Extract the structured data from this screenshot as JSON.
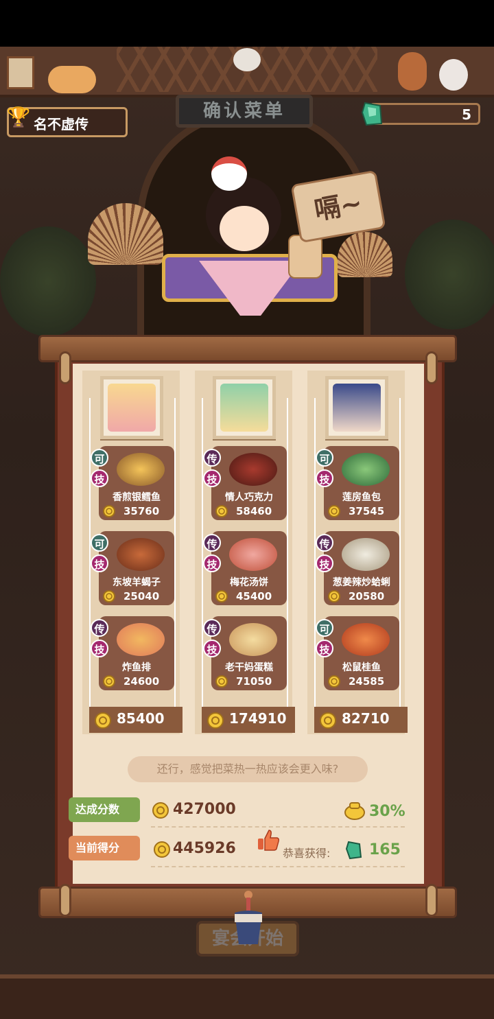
{
  "header": {
    "title_badge": "名不虚传",
    "sign_text": "确认菜单",
    "gem_count": "5"
  },
  "chef": {
    "speech": "嗝~"
  },
  "columns": [
    {
      "portrait": "chef-portrait-1",
      "dishes": [
        {
          "badge": "可",
          "skill": "技",
          "name": "香煎银鳕鱼",
          "price": "35760"
        },
        {
          "badge": "可",
          "skill": "技",
          "name": "东坡羊蝎子",
          "price": "25040"
        },
        {
          "badge": "传",
          "skill": "技",
          "name": "炸鱼排",
          "price": "24600"
        }
      ],
      "total": "85400"
    },
    {
      "portrait": "chef-portrait-2",
      "dishes": [
        {
          "badge": "传",
          "skill": "技",
          "name": "情人巧克力",
          "price": "58460"
        },
        {
          "badge": "传",
          "skill": "技",
          "name": "梅花汤饼",
          "price": "45400"
        },
        {
          "badge": "传",
          "skill": "技",
          "name": "老干妈蛋糕",
          "price": "71050"
        }
      ],
      "total": "174910"
    },
    {
      "portrait": "chef-portrait-3",
      "dishes": [
        {
          "badge": "可",
          "skill": "技",
          "name": "莲房鱼包",
          "price": "37545"
        },
        {
          "badge": "传",
          "skill": "技",
          "name": "葱姜辣炒蛤蜊",
          "price": "20580"
        },
        {
          "badge": "可",
          "skill": "技",
          "name": "松鼠桂鱼",
          "price": "24585"
        }
      ],
      "total": "82710"
    }
  ],
  "comment": "还行，感觉把菜热一热应该会更入味?",
  "summary": {
    "target_label": "达成分数",
    "target_score": "427000",
    "bonus_percent": "30%",
    "current_label": "当前得分",
    "current_score": "445926",
    "reward_label": "恭喜获得:",
    "reward_value": "165"
  },
  "start_button": "宴会开始",
  "colors": {
    "green": "#6aa24a",
    "brown": "#875743",
    "tag_ji": "#a4286e"
  }
}
